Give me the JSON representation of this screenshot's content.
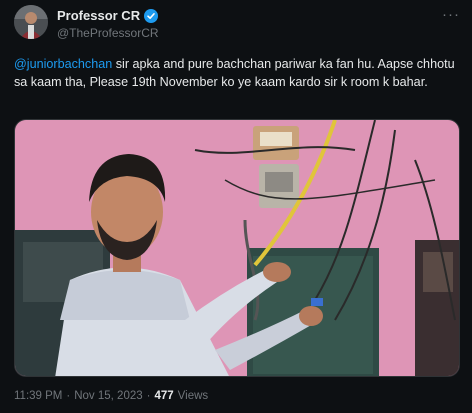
{
  "author": {
    "display_name": "Professor CR",
    "handle": "@TheProfessorCR"
  },
  "tweet": {
    "mention": "@juniorbachchan",
    "body": " sir apka and pure bachchan pariwar ka fan hu. Aapse chhotu sa kaam tha, Please 19th November ko ye kaam kardo sir k room k bahar."
  },
  "meta": {
    "time": "11:39 PM",
    "separator": "·",
    "date": "Nov 15, 2023",
    "views_count": "477",
    "views_label": "Views"
  },
  "icons": {
    "verified": "verified-badge-icon",
    "more": "more-options-icon"
  },
  "colors": {
    "accent": "#1d9bf0",
    "background": "#0d1013",
    "secondary_text": "#71767b"
  }
}
